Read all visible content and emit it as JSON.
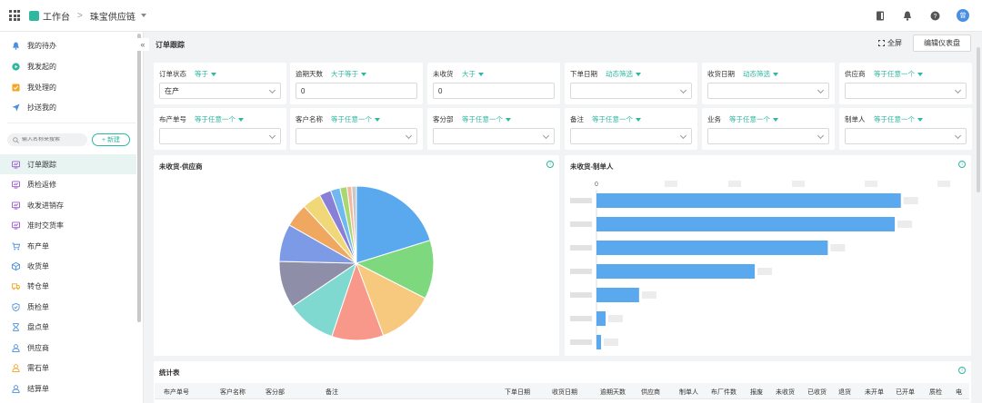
{
  "topbar": {
    "workspace": "工作台",
    "separator": ">",
    "app_name": "珠宝供应链",
    "avatar_text": "曾"
  },
  "sidebar": {
    "top_items": [
      {
        "label": "我的待办",
        "icon": "bell-icon",
        "color": "#4a90e2"
      },
      {
        "label": "我发起的",
        "icon": "play-circle-icon",
        "color": "#2fb7a0"
      },
      {
        "label": "我处理的",
        "icon": "check-box-icon",
        "color": "#f5a623"
      },
      {
        "label": "抄送我的",
        "icon": "send-icon",
        "color": "#4a90e2"
      }
    ],
    "search_placeholder": "输入名称来搜索",
    "new_button": "+ 新建",
    "nav_items": [
      {
        "label": "订单跟踪",
        "icon": "dashboard-icon",
        "color": "#9b59d0",
        "active": true
      },
      {
        "label": "质检返修",
        "icon": "dashboard-icon",
        "color": "#9b59d0"
      },
      {
        "label": "收发进销存",
        "icon": "dashboard-icon",
        "color": "#9b59d0"
      },
      {
        "label": "准时交货率",
        "icon": "dashboard-icon",
        "color": "#9b59d0"
      },
      {
        "label": "布产单",
        "icon": "cart-icon",
        "color": "#4a90e2"
      },
      {
        "label": "收货单",
        "icon": "box-icon",
        "color": "#4a90e2"
      },
      {
        "label": "转仓单",
        "icon": "truck-icon",
        "color": "#f5a623"
      },
      {
        "label": "质检单",
        "icon": "shield-icon",
        "color": "#4a90e2"
      },
      {
        "label": "盘点单",
        "icon": "hourglass-icon",
        "color": "#4a90e2"
      },
      {
        "label": "供应商",
        "icon": "user-icon",
        "color": "#4a90e2"
      },
      {
        "label": "需石单",
        "icon": "user-icon",
        "color": "#f5a623"
      },
      {
        "label": "结算单",
        "icon": "user-icon",
        "color": "#4a90e2"
      }
    ]
  },
  "header": {
    "title": "订单跟踪",
    "fullscreen": "全屏",
    "edit_dashboard": "编辑仪表盘"
  },
  "filters": [
    {
      "label": "订单状态",
      "op": "等于",
      "value": "在产",
      "dropdown": true
    },
    {
      "label": "逾期天数",
      "op": "大于等于",
      "value": "0",
      "dropdown": false
    },
    {
      "label": "未收货",
      "op": "大于",
      "value": "0",
      "dropdown": false
    },
    {
      "label": "下单日期",
      "op": "动态筛选",
      "value": "",
      "dropdown": true
    },
    {
      "label": "收货日期",
      "op": "动态筛选",
      "value": "",
      "dropdown": true
    },
    {
      "label": "供应商",
      "op": "等于任意一个",
      "value": "",
      "dropdown": true
    },
    {
      "label": "布产单号",
      "op": "等于任意一个",
      "value": "",
      "dropdown": true
    },
    {
      "label": "客户名称",
      "op": "等于任意一个",
      "value": "",
      "dropdown": true
    },
    {
      "label": "客分部",
      "op": "等于任意一个",
      "value": "",
      "dropdown": true
    },
    {
      "label": "备注",
      "op": "等于任意一个",
      "value": "",
      "dropdown": true
    },
    {
      "label": "业务",
      "op": "等于任意一个",
      "value": "",
      "dropdown": true
    },
    {
      "label": "制单人",
      "op": "等于任意一个",
      "value": "",
      "dropdown": true
    }
  ],
  "chart_data": [
    {
      "type": "pie",
      "title": "未收货-供应商",
      "values": [
        20.5,
        12.5,
        12,
        11,
        10.5,
        10,
        8,
        5,
        4,
        2.5,
        2,
        1.5,
        1,
        1
      ],
      "colors": [
        "#5aa9ee",
        "#7ed97e",
        "#f7c97e",
        "#f7988a",
        "#7fd9d0",
        "#8e8ea8",
        "#7c9ae6",
        "#f0a860",
        "#f0d878",
        "#8a7fd6",
        "#70b8f0",
        "#a8d870",
        "#f3b6a0",
        "#c8c8c8"
      ]
    },
    {
      "type": "bar",
      "orientation": "horizontal",
      "title": "未收货-制单人",
      "x_tick_first": "0",
      "values": [
        100,
        98,
        76,
        52,
        14,
        3,
        1.5
      ],
      "xlim": [
        0,
        118
      ],
      "color": "#5aa9ee"
    }
  ],
  "table": {
    "title": "统计表",
    "columns": [
      "布产单号",
      "客户名称",
      "客分部",
      "备注",
      "下单日期",
      "收货日期",
      "逾期天数",
      "供应商",
      "制单人",
      "布厂件数",
      "报废",
      "未收货",
      "已收货",
      "退货",
      "未开单",
      "已开单",
      "质检",
      "电"
    ]
  }
}
